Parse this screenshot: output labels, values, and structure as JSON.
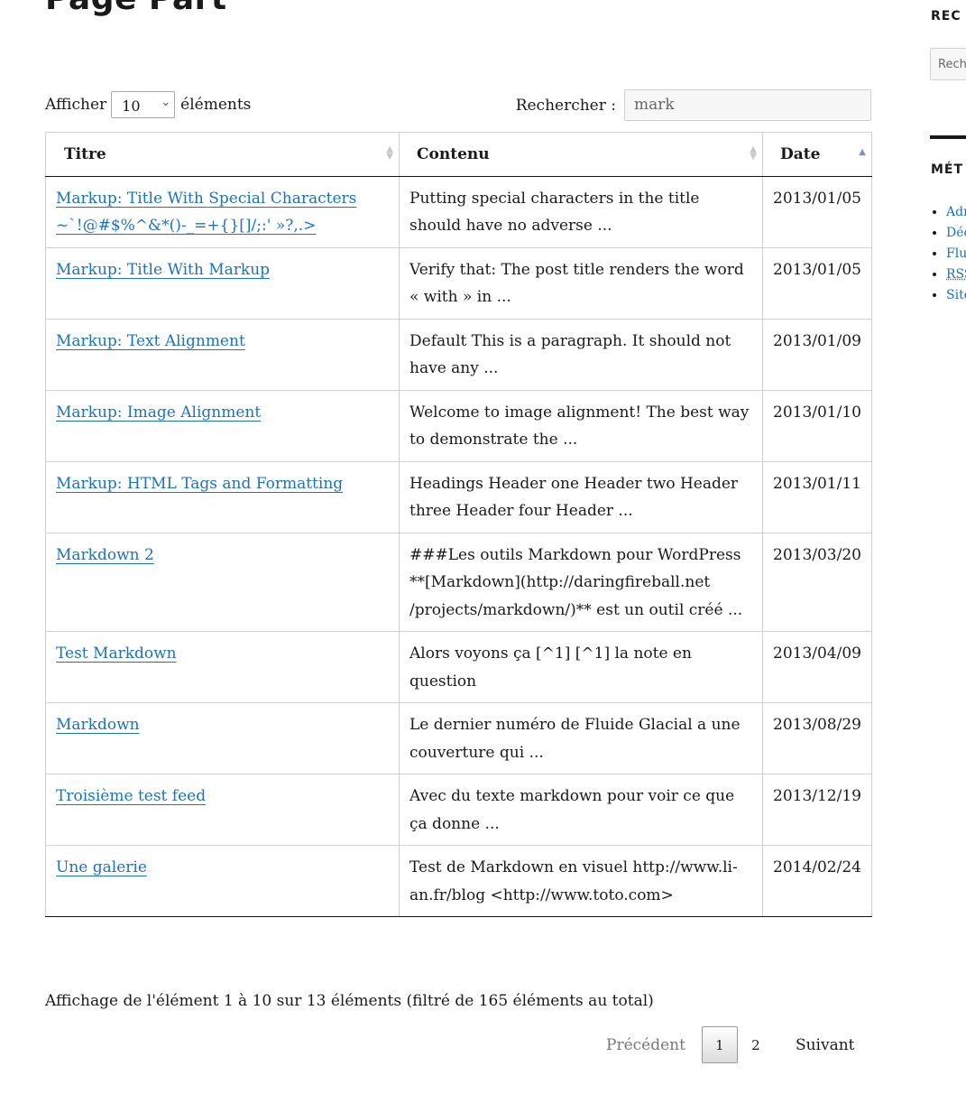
{
  "page": {
    "title": "Page Part"
  },
  "length": {
    "prefix": "Afficher",
    "value": "10",
    "suffix": "éléments"
  },
  "search": {
    "label": "Rechercher :",
    "value": "mark"
  },
  "table": {
    "headers": [
      "Titre",
      "Contenu",
      "Date"
    ],
    "rows": [
      {
        "title": "Markup: Title With Special Characters ~`!@#$%^&*()-_=+{}[]/;:' »?,.>",
        "content": "Putting special characters in the title should have no adverse ...",
        "date": "2013/01/05"
      },
      {
        "title": "Markup: Title With Markup",
        "content": "Verify that: The post title renders the word « with » in ...",
        "date": "2013/01/05"
      },
      {
        "title": "Markup: Text Alignment",
        "content": "Default This is a paragraph. It should not have any ...",
        "date": "2013/01/09"
      },
      {
        "title": "Markup: Image Alignment",
        "content": "Welcome to image alignment! The best way to demonstrate the ...",
        "date": "2013/01/10"
      },
      {
        "title": "Markup: HTML Tags and Formatting",
        "content": "Headings Header one Header two Header three Header four Header ...",
        "date": "2013/01/11"
      },
      {
        "title": "Markdown 2",
        "content": "###Les outils Markdown pour WordPress **[Markdown](http://daringfireball.net /projects/markdown/)** est un outil créé ...",
        "date": "2013/03/20"
      },
      {
        "title": "Test Markdown",
        "content": "Alors voyons ça [^1] [^1] la note en question",
        "date": "2013/04/09"
      },
      {
        "title": "Markdown",
        "content": "Le dernier numéro de Fluide Glacial a une couverture qui ...",
        "date": "2013/08/29"
      },
      {
        "title": "Troisième test feed",
        "content": "Avec du texte markdown pour voir ce que ça donne ...",
        "date": "2013/12/19"
      },
      {
        "title": "Une galerie",
        "content": "Test de Markdown en visuel http://www.li-an.fr/blog <http://www.toto.com>",
        "date": "2014/02/24"
      }
    ]
  },
  "info": "Affichage de l'élément 1 à 10 sur 13 éléments (filtré de 165 éléments au total)",
  "pagination": {
    "previous": "Précédent",
    "pages": [
      "1",
      "2"
    ],
    "current": "1",
    "next": "Suivant"
  },
  "sidebar": {
    "search_title": "REC",
    "search_placeholder": "Rech",
    "meta_title": "MÉT",
    "meta_items": [
      "Adr",
      "Déc",
      "Flu",
      "RSS",
      "Site"
    ]
  },
  "colors": {
    "link": "#1a73c0",
    "sort_active": "#7f8fd6",
    "border": "#d1d1d1"
  }
}
